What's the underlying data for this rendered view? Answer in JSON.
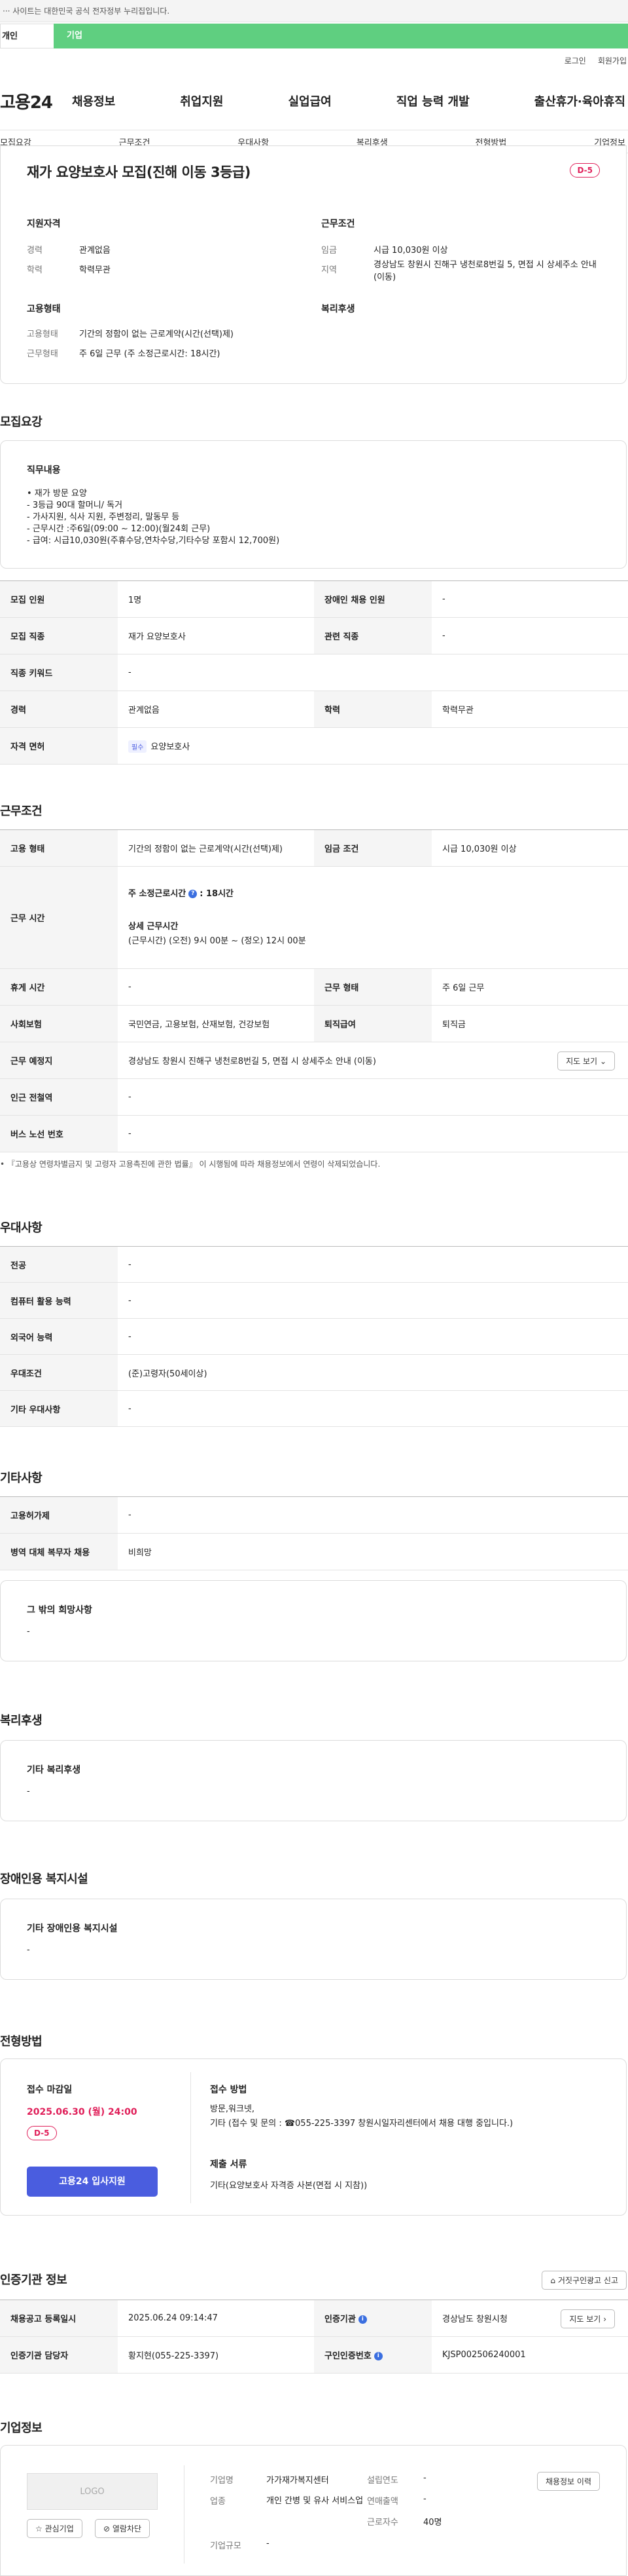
{
  "header": {
    "notice": "··· 사이트는 대한민국 공식 전자정부 누리집입니다.",
    "tab_individual": "개인",
    "tab_corporate": "기업",
    "login": "로그인",
    "join": "회원가입",
    "logo": "고용24",
    "menu": [
      "채용정보",
      "취업지원",
      "실업급여",
      "직업 능력 개발",
      "출산휴가·육아휴직"
    ]
  },
  "subnav": [
    "모집요강",
    "근무조건",
    "우대사항",
    "복리후생",
    "전형방법",
    "기업정보"
  ],
  "summary": {
    "title": "재가 요양보호사 모집(진해 이동 3등급)",
    "dday": "D-5",
    "qual_head": "지원자격",
    "career_label": "경력",
    "career_value": "관계없음",
    "edu_label": "학력",
    "edu_value": "학력무관",
    "cond_head": "근무조건",
    "wage_label": "임금",
    "wage_value": "시급 10,030원 이상",
    "loc_label": "지역",
    "loc_value": "경상남도 창원시 진해구 냉천로8번길 5, 면접 시 상세주소 안내 (이동)",
    "emp_head": "고용형태",
    "type_label": "고용형태",
    "type_value": "기간의 정함이 없는 근로계약(시간(선택)제)",
    "hours_label": "근무형태",
    "hours_value": "주 6일 근무 (주 소정근로시간: 18시간)",
    "welfare_head": "복리후생"
  },
  "recruit": {
    "section_title": "모집요강",
    "duty_head": "직무내용",
    "duty_lines": [
      "• 재가 방문 요양",
      "- 3등급 90대 할머니/ 독거",
      "- 가사지원, 식사 지원, 주변정리, 말동무 등",
      "- 근무시간 :주6일(09:00 ~ 12:00)(월24회 근무)",
      "- 급여: 시급10,030원(주휴수당,연차수당,기타수당 포함시 12,700원)"
    ],
    "rows": [
      [
        "모집 인원",
        "1명",
        "장애인 채용 인원",
        "-"
      ],
      [
        "모집 직종",
        "재가 요양보호사",
        "관련 직종",
        "-"
      ],
      [
        "직종 키워드",
        "-"
      ],
      [
        "경력",
        "관계없음",
        "학력",
        "학력무관"
      ]
    ],
    "license_label": "자격 면허",
    "license_chip": "필수",
    "license_value": "요양보호사"
  },
  "conditions": {
    "section_title": "근무조건",
    "type_label": "고용 형태",
    "type_value": "기간의 정함이 없는 근로계약(시간(선택)제)",
    "wage_label": "임금 조건",
    "wage_value": "시급 10,030원 이상",
    "time_label": "근무 시간",
    "weekly": "주 소정근로시간",
    "weekly_info": "?",
    "weekly_value": ": 18시간",
    "detail_head": "상세 근무시간",
    "detail_value": "(근무시간) (오전) 9시 00분 ~ (정오) 12시 00분",
    "rest_label": "휴게 시간",
    "rest_value": "-",
    "form_label": "근무 형태",
    "form_value": "주 6일 근무",
    "ins_label": "사회보험",
    "ins_value": "국민연금, 고용보험, 산재보험, 건강보험",
    "sev_label": "퇴직급여",
    "sev_value": "퇴직금",
    "place_label": "근무 예정지",
    "place_value": "경상남도 창원시 진해구 냉천로8번길 5, 면접 시 상세주소 안내 (이동)",
    "map_btn": "지도 보기",
    "station_label": "인근 전철역",
    "station_value": "-",
    "bus_label": "버스 노선 번호",
    "bus_value": "-",
    "notice": "• 『고용상 연령차별금지 및 고령자 고용촉진에 관한 법률』 이 시행됨에 따라 채용정보에서 연령이 삭제되었습니다."
  },
  "preference": {
    "section_title": "우대사항",
    "rows": [
      [
        "전공",
        "-"
      ],
      [
        "컴퓨터 활용 능력",
        "-"
      ],
      [
        "외국어 능력",
        "-"
      ],
      [
        "우대조건",
        "(준)고령자(50세이상)"
      ],
      [
        "기타 우대사항",
        "-"
      ]
    ]
  },
  "etc": {
    "section_title": "기타사항",
    "rows": [
      [
        "고용허가제",
        "-"
      ],
      [
        "병역 대체 복무자 채용",
        "비희망"
      ]
    ],
    "hope_head": "그 밖의 희망사항",
    "hope_value": "-"
  },
  "welfare": {
    "section_title": "복리후생",
    "head": "기타 복리후생",
    "value": "-"
  },
  "disability": {
    "section_title": "장애인용 복지시설",
    "head": "기타 장애인용 복지시설",
    "value": "-"
  },
  "screening": {
    "section_title": "전형방법",
    "deadline_head": "접수 마감일",
    "deadline": "2025.06.30 (월) 24:00",
    "dday": "D-5",
    "apply_btn": "고용24 입사지원",
    "method_head": "접수 방법",
    "method_value": "방문,워크넷,\n기타 (접수 및 문의 : ☎055-225-3397 창원시일자리센터에서 채용 대행 중입니다.)",
    "docs_head": "제출 서류",
    "docs_value": "기타(요양보호사 자격증 사본(면접 시 지참))"
  },
  "agency": {
    "section_title": "인증기관 정보",
    "report_btn": "거짓구인광고 신고",
    "reg_label": "채용공고 등록일시",
    "reg_value": "2025.06.24 09:14:47",
    "agency_label": "인증기관",
    "agency_value": "경상남도 창원시청",
    "map_btn": "지도 보기",
    "manager_label": "인증기관 담당자",
    "manager_value": "황지현(055-225-3397)",
    "num_label": "구인인증번호",
    "num_value": "KJSP002506240001"
  },
  "company": {
    "section_title": "기업정보",
    "logo": "LOGO",
    "interest_btn": "관심기업",
    "block_btn": "열람차단",
    "name_label": "기업명",
    "name_value": "가가재가복지센터",
    "industry_label": "업종",
    "industry_value": "개인 간병 및 유사 서비스업",
    "scale_label": "기업규모",
    "scale_value": "-",
    "year_label": "설립연도",
    "year_value": "-",
    "sales_label": "연매출액",
    "sales_value": "-",
    "emp_label": "근로자수",
    "emp_value": "40명",
    "history_btn": "채용정보 이력"
  }
}
